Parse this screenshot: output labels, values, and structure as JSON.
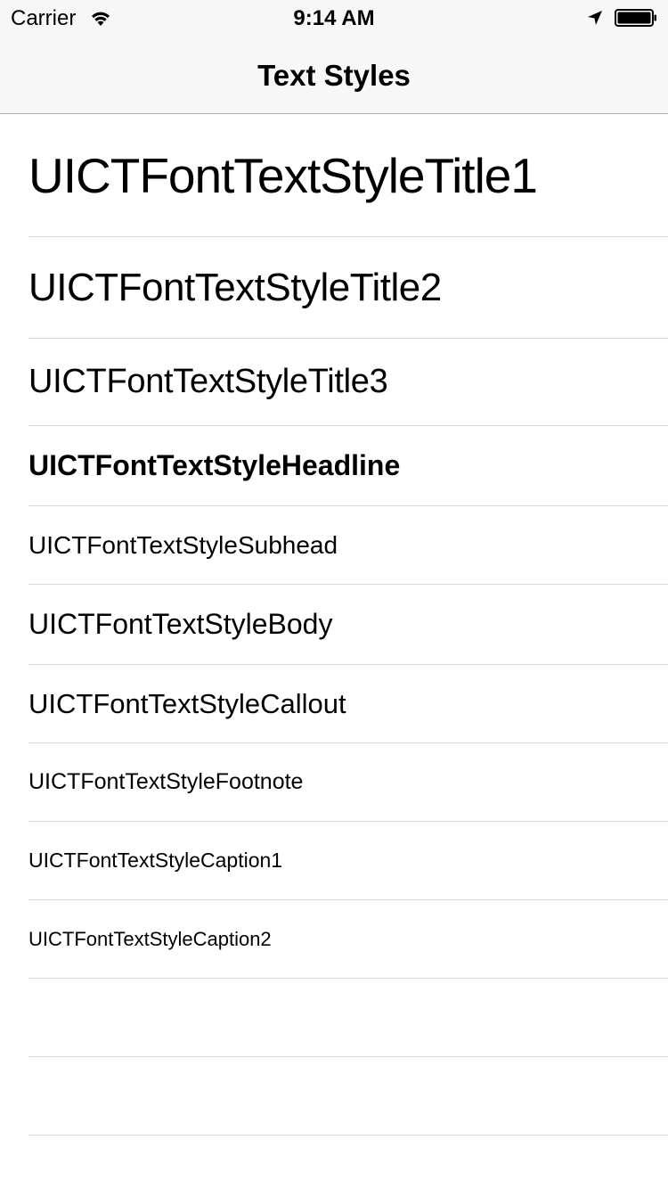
{
  "status_bar": {
    "carrier": "Carrier",
    "time": "9:14 AM",
    "icons": [
      "wifi-icon",
      "location-arrow-icon",
      "battery-icon"
    ],
    "battery_level": 1.0
  },
  "nav": {
    "title": "Text Styles",
    "background": "#f7f7f7"
  },
  "list": {
    "rows": [
      {
        "label": "UICTFontTextStyleTitle1"
      },
      {
        "label": "UICTFontTextStyleTitle2"
      },
      {
        "label": "UICTFontTextStyleTitle3"
      },
      {
        "label": "UICTFontTextStyleHeadline"
      },
      {
        "label": "UICTFontTextStyleSubhead"
      },
      {
        "label": "UICTFontTextStyleBody"
      },
      {
        "label": "UICTFontTextStyleCallout"
      },
      {
        "label": "UICTFontTextStyleFootnote"
      },
      {
        "label": "UICTFontTextStyleCaption1"
      },
      {
        "label": "UICTFontTextStyleCaption2"
      },
      {
        "label": ""
      },
      {
        "label": ""
      }
    ],
    "separator_color": "#d8d8dc"
  }
}
